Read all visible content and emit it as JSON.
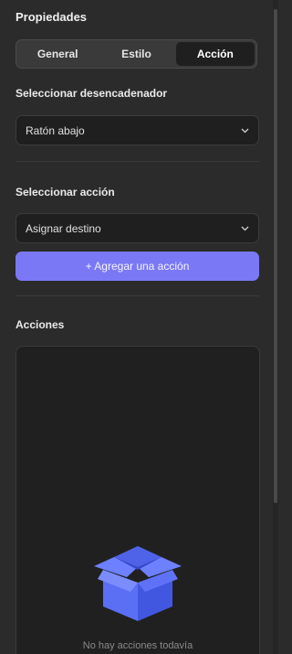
{
  "panel": {
    "title": "Propiedades"
  },
  "tabs": [
    {
      "label": "General",
      "active": false
    },
    {
      "label": "Estilo",
      "active": false
    },
    {
      "label": "Acción",
      "active": true
    }
  ],
  "trigger": {
    "label": "Seleccionar desencadenador",
    "value": "Ratón abajo"
  },
  "action": {
    "label": "Seleccionar acción",
    "value": "Asignar destino",
    "add_button": "+ Agregar una acción"
  },
  "actions_list": {
    "label": "Acciones",
    "empty_text": "No hay acciones todavía",
    "empty_icon": "open-box-icon"
  },
  "colors": {
    "accent": "#7b78f6",
    "box": "#5b6ff5"
  }
}
